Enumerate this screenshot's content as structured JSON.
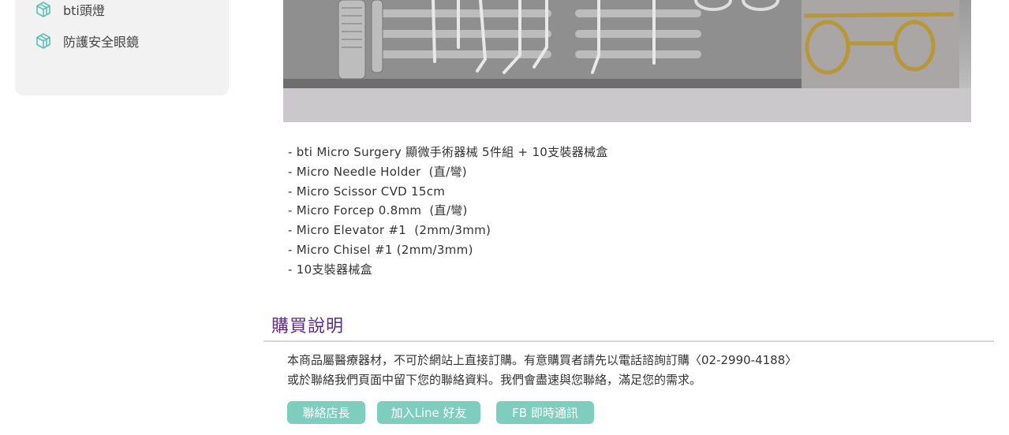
{
  "sidebar": {
    "items": [
      {
        "label": "bti頭燈"
      },
      {
        "label": "防護安全眼鏡"
      }
    ],
    "icon": "cube-outline-icon",
    "icon_color": "#5bc0b6"
  },
  "product": {
    "description": [
      "- bti Micro Surgery 顯微手術器械 5件組 + 10支裝器械盒",
      "- Micro Needle Holder  (直/彎)",
      "- Micro Scissor CVD 15cm",
      "- Micro Forcep 0.8mm  (直/彎)",
      "- Micro Elevator #1  (2mm/3mm)",
      "- Micro Chisel #1 (2mm/3mm)",
      "- 10支裝器械盒"
    ]
  },
  "purchase": {
    "title": "購買說明",
    "title_color": "#5e2a84",
    "note_line1": "本商品屬醫療器材，不可於網站上直接訂購。有意購買者請先以電話諮詢訂購〈02-2990-4188〉",
    "note_line2": "或於聯絡我們頁面中留下您的聯絡資料。我們會盡速與您聯絡，滿足您的需求。",
    "buttons": [
      {
        "label": "聯絡店長"
      },
      {
        "label": "加入Line 好友"
      },
      {
        "label": "FB 即時通訊"
      }
    ],
    "button_color": "#7ecdbf"
  }
}
